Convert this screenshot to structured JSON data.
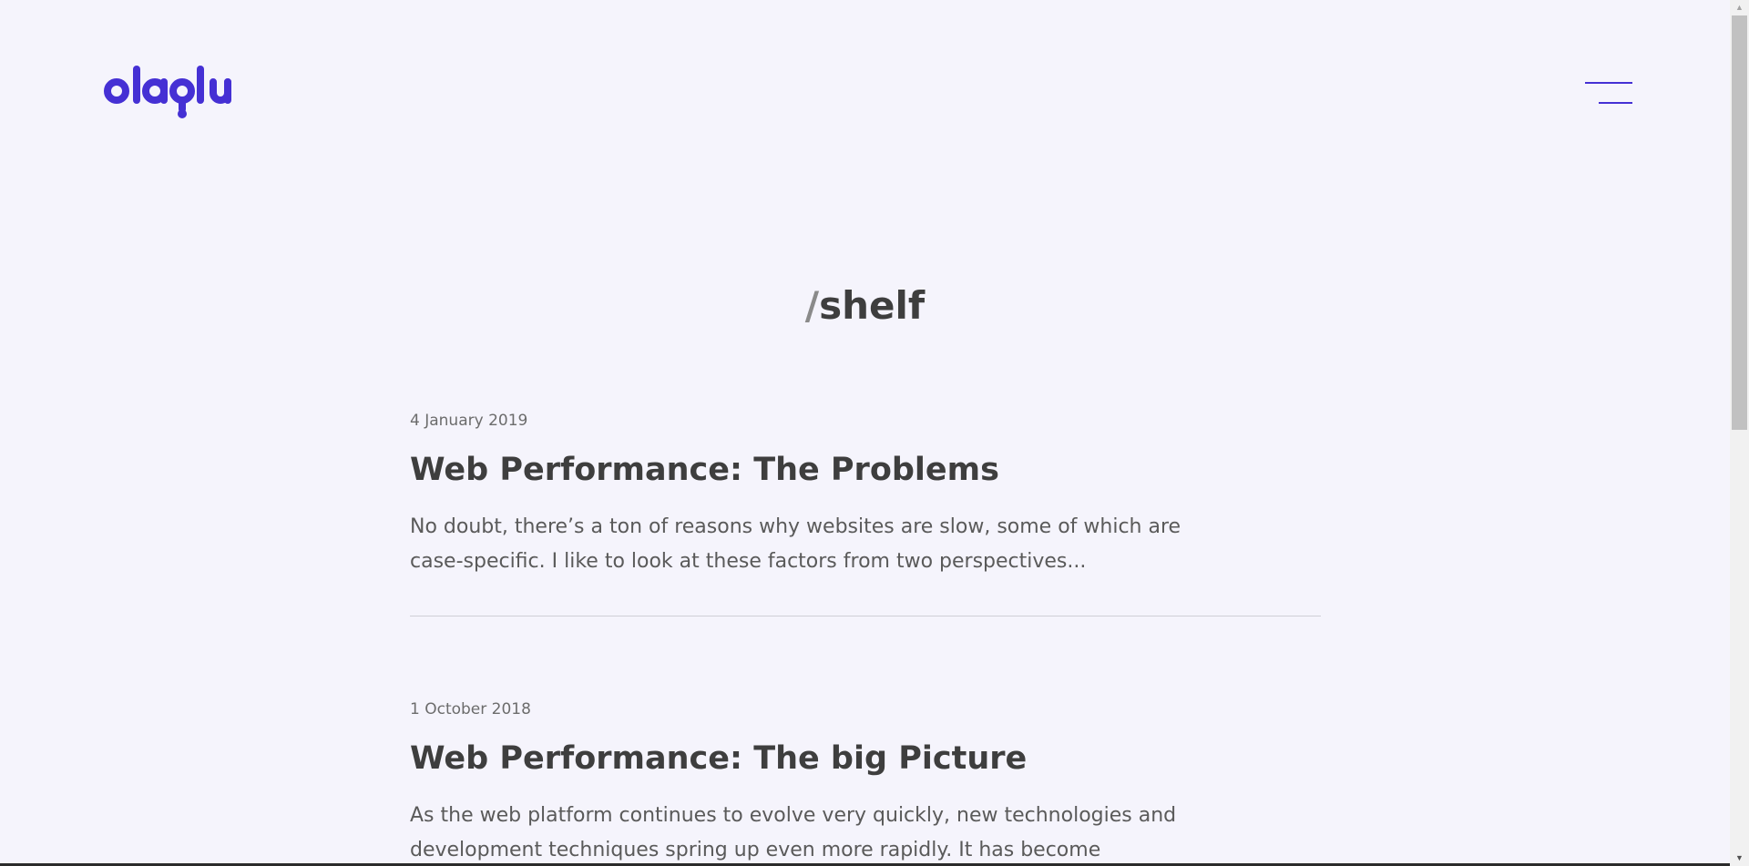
{
  "header": {
    "logo_text": "olaolu",
    "menu_icon": "hamburger-menu-icon"
  },
  "page": {
    "title_slash": "/",
    "title_text": "shelf"
  },
  "posts": [
    {
      "date": "4 January 2019",
      "title": "Web Performance: The Problems",
      "excerpt": "No doubt, there’s a ton of reasons why websites are slow, some of which are case-specific. I like to look at these factors from two perspectives..."
    },
    {
      "date": "1 October 2018",
      "title": "Web Performance: The big Picture",
      "excerpt": "As the web platform continues to evolve very quickly, new technologies and development techniques spring up even more rapidly. It has become alarming"
    }
  ],
  "colors": {
    "accent": "#4530d4",
    "background": "#f5f4fc",
    "heading": "#3e3e3e"
  }
}
